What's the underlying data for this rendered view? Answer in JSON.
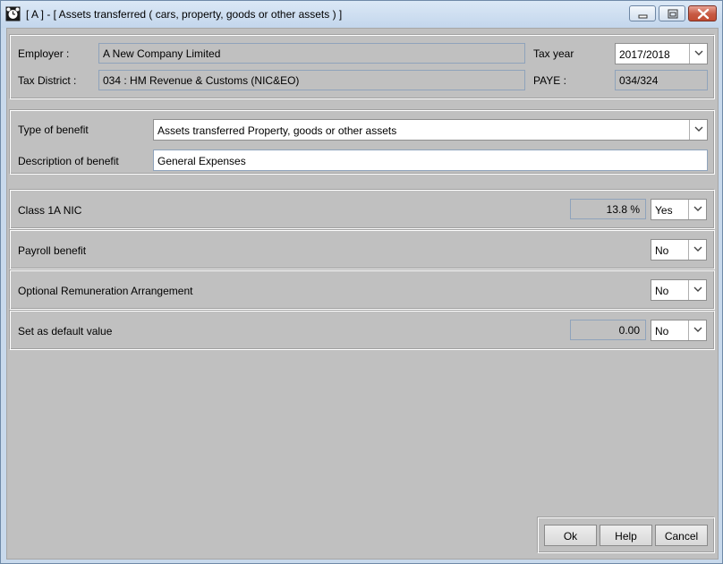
{
  "window": {
    "title": "[ A ] - [ Assets transferred ( cars, property, goods or other assets ) ]"
  },
  "employer": {
    "employer_label": "Employer :",
    "employer_value": "A New Company Limited",
    "tax_year_label": "Tax year",
    "tax_year_value": "2017/2018",
    "tax_district_label": "Tax District :",
    "tax_district_value": "034 : HM Revenue & Customs (NIC&EO)",
    "paye_label": "PAYE :",
    "paye_value": "034/324"
  },
  "benefit": {
    "type_label": "Type of benefit",
    "type_value": "Assets transferred Property, goods or other assets",
    "description_label": "Description of benefit",
    "description_value": "General Expenses"
  },
  "options": [
    {
      "label": "Class 1A NIC",
      "field_value": "13.8 %",
      "choice": "Yes"
    },
    {
      "label": "Payroll benefit",
      "choice": "No"
    },
    {
      "label": "Optional Remuneration Arrangement",
      "choice": "No"
    },
    {
      "label": "Set as default value",
      "field_value": "0.00",
      "choice": "No"
    }
  ],
  "buttons": {
    "ok": "Ok",
    "help": "Help",
    "cancel": "Cancel"
  },
  "colors": {
    "title_gradient_top": "#dbe8f6",
    "client_background": "#c0c0c0",
    "close_button": "#c75a43"
  }
}
